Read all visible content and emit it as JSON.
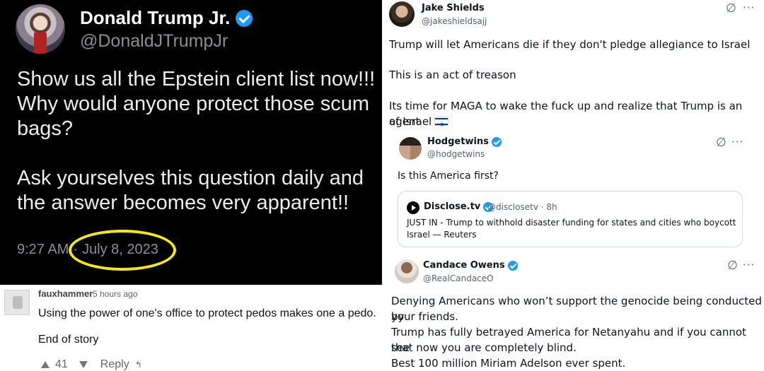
{
  "dark_tweet": {
    "name": "Donald Trump Jr.",
    "handle": "@DonaldJTrumpJr",
    "body": [
      "Show us all the Epstein client list now!!! Why would anyone protect those scum bags?",
      "Ask yourselves this question daily and the answer becomes very apparent!!"
    ],
    "time": "9:27 AM",
    "separator": "·",
    "date": "July 8, 2023",
    "highlight_color": "#f5e80a"
  },
  "comment": {
    "username": "fauxhammer",
    "time": "5 hours ago",
    "lines": [
      "Using the power of one's office to protect pedos makes one a pedo.",
      "End of story"
    ],
    "votes": "41",
    "reply_label": "Reply"
  },
  "jake": {
    "name": "Jake Shields",
    "handle": "@jakeshieldsajj",
    "paragraphs": [
      "Trump will let Americans die if they don't pledge allegiance to Israel",
      "This is an act of treason",
      "Its time for MAGA to wake the fuck up and realize that Trump is an agent",
      "of Israel"
    ]
  },
  "hodgetwins": {
    "name": "Hodgetwins",
    "handle": "@hodgetwins",
    "text": "Is this America first?"
  },
  "disclose": {
    "name": "Disclose.tv",
    "handle": "@disclosetv · 8h",
    "text": "JUST IN - Trump to withhold disaster funding for states and cities who boycott Israel — Reuters"
  },
  "candace": {
    "name": "Candace Owens",
    "handle": "@RealCandaceO",
    "lines": [
      "Denying Americans who won’t support the genocide being conducted by",
      "your friends.",
      "Trump has fully betrayed America for Netanyahu and if you cannot see",
      "that now you are completely blind.",
      "Best 100 million Miriam Adelson ever spent."
    ]
  },
  "icons": {
    "grok": "∅",
    "more": "···",
    "vote_up": "up-triangle",
    "vote_down": "down-triangle",
    "reply_arrow": "↰"
  },
  "colors": {
    "verified": "#1d9bf0",
    "muted": "#536471"
  }
}
